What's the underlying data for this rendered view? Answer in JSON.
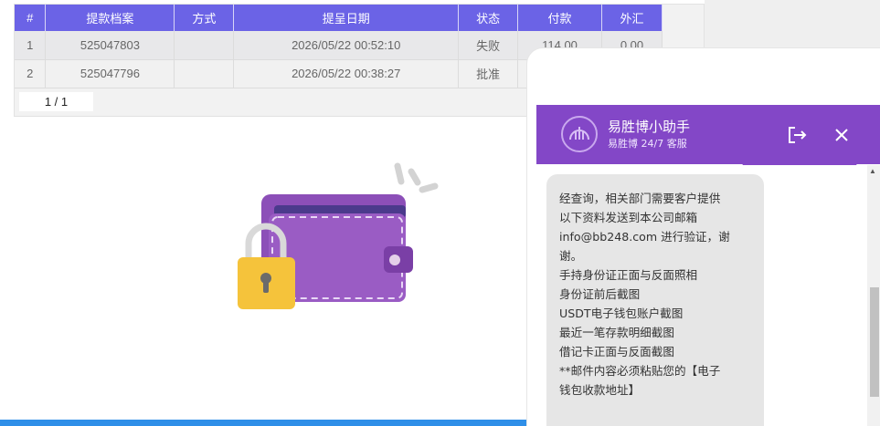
{
  "table": {
    "headers": [
      "#",
      "提款档案",
      "方式",
      "提呈日期",
      "状态",
      "付款",
      "外汇"
    ],
    "rows": [
      [
        "1",
        "525047803",
        "",
        "2026/05/22 00:52:10",
        "失败",
        "114.00",
        "0.00"
      ],
      [
        "2",
        "525047796",
        "",
        "2026/05/22 00:38:27",
        "批准",
        "",
        ""
      ]
    ],
    "pagination": "1 / 1"
  },
  "chat": {
    "title": "易胜博小助手",
    "subtitle": "易胜博 24/7 客服",
    "message": "经查询，相关部门需要客户提供\n以下资料发送到本公司邮箱\ninfo@bb248.com 进行验证，谢\n谢。\n手持身份证正面与反面照相\n身份证前后截图\nUSDT电子钱包账户截图\n最近一笔存款明细截图\n借记卡正面与反面截图\n**邮件内容必须粘贴您的【电子\n钱包收款地址】",
    "header_color": "#8347c7"
  },
  "colors": {
    "table_header": "#6b63e6",
    "bottom_bar": "#2f8fe8"
  },
  "icons": {
    "logout": "logout-icon",
    "close": "close-icon",
    "wallet": "wallet-illustration",
    "lock": "lock-icon"
  }
}
